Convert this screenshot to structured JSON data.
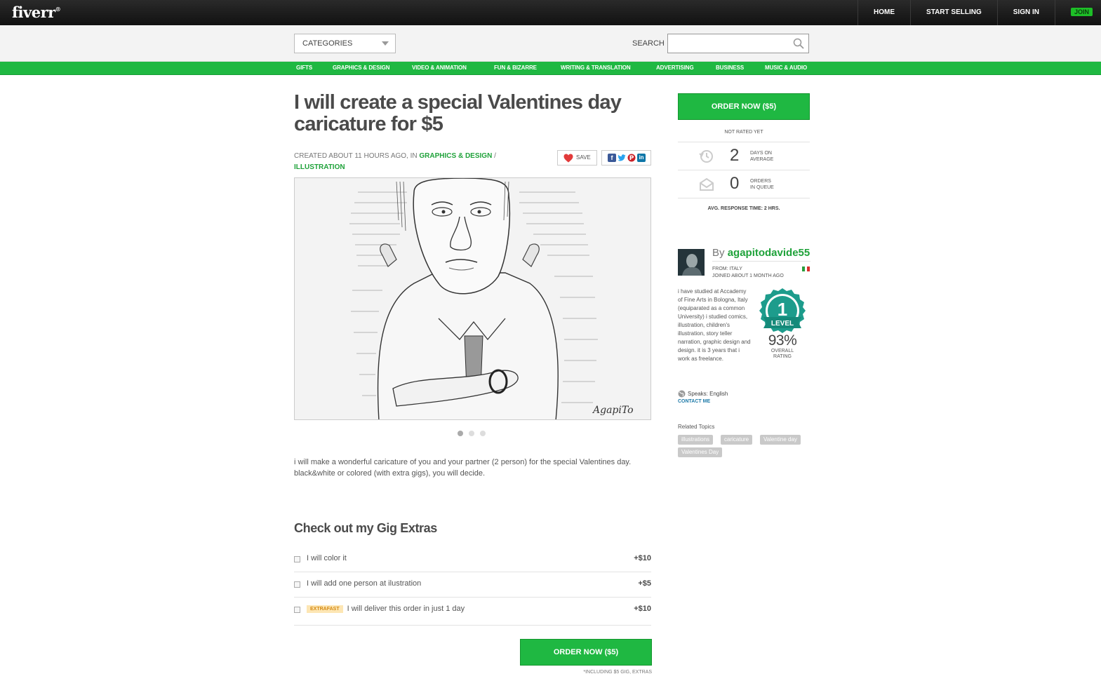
{
  "topbar": {
    "logo": "fiverr",
    "nav": [
      "HOME",
      "START SELLING",
      "SIGN IN"
    ],
    "join_label": "JOIN"
  },
  "search": {
    "categories_label": "CATEGORIES",
    "search_label": "SEARCH",
    "placeholder": ""
  },
  "categories": [
    "GIFTS",
    "GRAPHICS & DESIGN",
    "VIDEO & ANIMATION",
    "FUN & BIZARRE",
    "WRITING & TRANSLATION",
    "ADVERTISING",
    "BUSINESS",
    "MUSIC & AUDIO"
  ],
  "gig": {
    "title": "I will create a special Valentines day caricature for $5",
    "meta_prefix": "CREATED ABOUT 11 HOURS AGO, IN",
    "category_link": "GRAPHICS & DESIGN",
    "sep": "/",
    "subcategory_link": "ILLUSTRATION",
    "save_label": "SAVE",
    "signature": "AgapiTo",
    "description_line1": "i will make a wonderful caricature of you and your partner (2 person) for the special Valentines day.",
    "description_line2": "black&white or colored (with extra gigs), you will decide."
  },
  "extras": {
    "title": "Check out my Gig Extras",
    "items": [
      {
        "label": "I will color it",
        "price": "+$10",
        "badge": ""
      },
      {
        "label": "I will add one person at ilustration",
        "price": "+$5",
        "badge": ""
      },
      {
        "label": "I will deliver this order in just 1 day",
        "price": "+$10",
        "badge": "EXTRAFAST"
      }
    ],
    "order_label": "ORDER NOW ($5)",
    "including_note": "*INCLUDING $5 GIG, EXTRAS"
  },
  "sidebar": {
    "order_label": "ORDER NOW ($5)",
    "not_rated": "NOT RATED YET",
    "days_num": "2",
    "days_label_1": "DAYS ON",
    "days_label_2": "AVERAGE",
    "orders_num": "0",
    "orders_label_1": "ORDERS",
    "orders_label_2": "IN QUEUE",
    "response_time": "AVG. RESPONSE TIME: 2 HRS."
  },
  "seller": {
    "by": "By",
    "username": "agapitodavide55",
    "from": "FROM: ITALY",
    "joined": "JOINED ABOUT 1 MONTH AGO",
    "bio": "i have studied at Accademy of Fine Arts in Bologna, Italy (equiparated as a common University) i studied comics, illustration, children's illustration, story teller narration, graphic design and design. it is 3 years that i work as freelance.",
    "level_num": "1",
    "level_label": "LEVEL",
    "rating": "93%",
    "rating_label_1": "OVERALL",
    "rating_label_2": "RATING",
    "speaks": "Speaks: English",
    "contact": "CONTACT ME"
  },
  "related": {
    "title": "Related Topics",
    "tags": [
      "illustrations",
      "caricature",
      "Valentine day",
      "Valentines Day"
    ]
  },
  "colors": {
    "brand_green": "#1fb842",
    "link_green": "#1fa23a",
    "topbar": "#1a1a1a",
    "level_teal": "#1d9c8c"
  }
}
